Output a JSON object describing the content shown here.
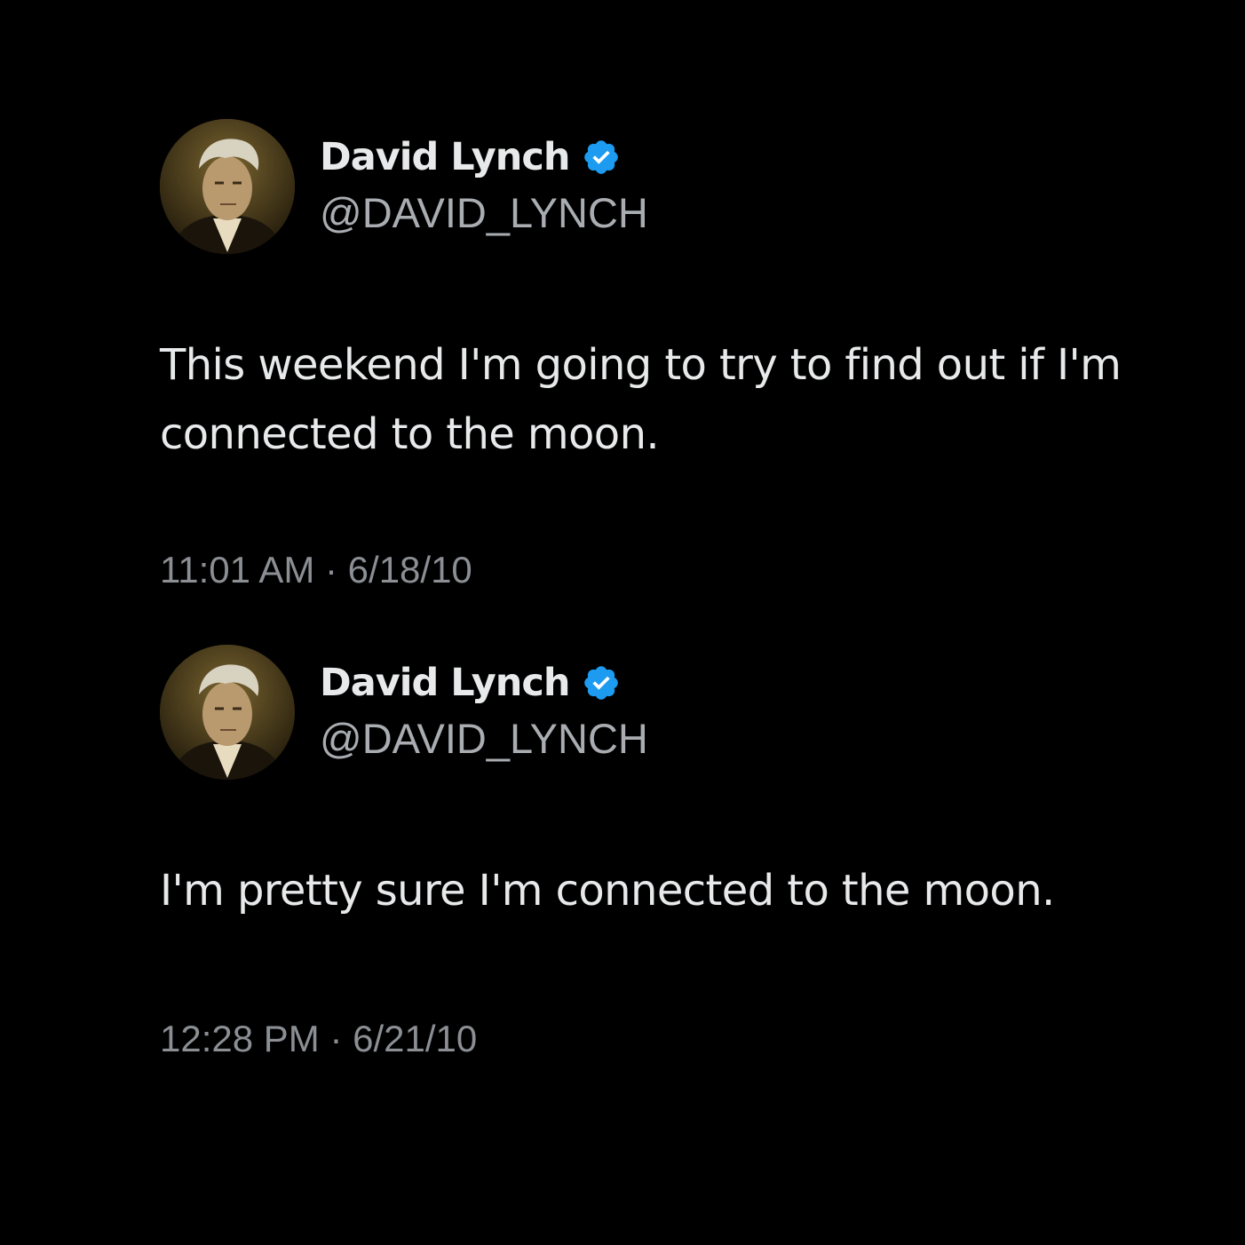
{
  "theme": {
    "background": "#000000",
    "text_primary": "#e7e9ea",
    "text_secondary": "#a9adb1",
    "verified_badge": "#1d9bf0"
  },
  "tweets": [
    {
      "author": {
        "display_name": "David Lynch",
        "handle": "@DAVID_LYNCH",
        "verified": true,
        "avatar": "profile-photo"
      },
      "text": "This weekend I'm going to try to find out if I'm\nconnected to the moon.",
      "timestamp": "11:01 AM · 6/18/10"
    },
    {
      "author": {
        "display_name": "David Lynch",
        "handle": "@DAVID_LYNCH",
        "verified": true,
        "avatar": "profile-photo"
      },
      "text": "I'm pretty sure I'm connected to the moon.",
      "timestamp": "12:28 PM · 6/21/10"
    }
  ]
}
